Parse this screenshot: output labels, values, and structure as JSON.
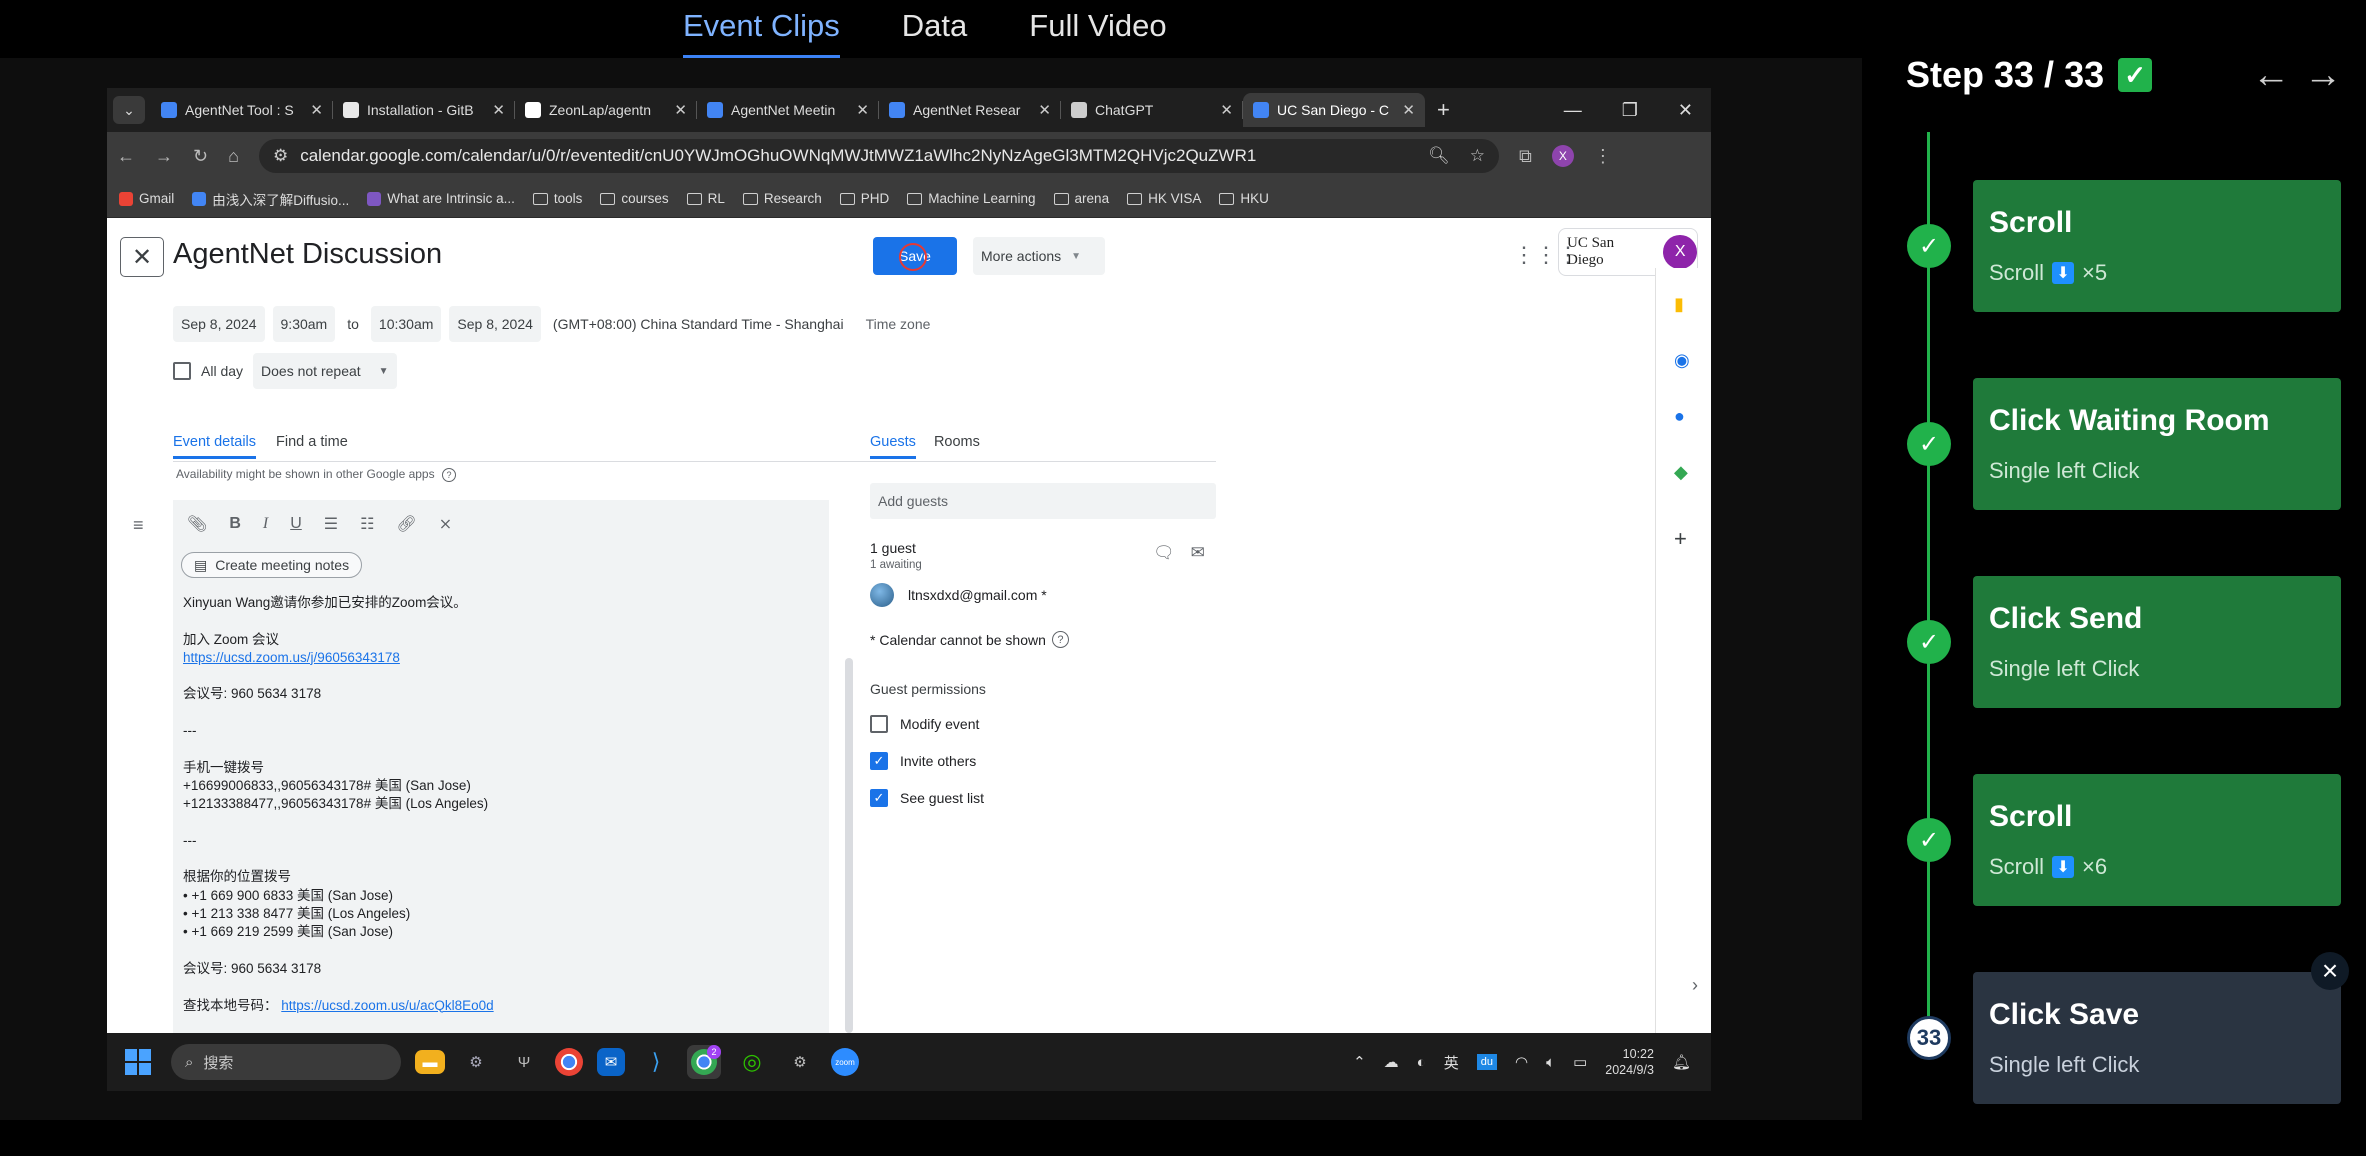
{
  "top_tabs": [
    "Event Clips",
    "Data",
    "Full Video"
  ],
  "browser": {
    "tabs": [
      {
        "label": "AgentNet Tool : S",
        "fav_color": "#4285f4"
      },
      {
        "label": "Installation - GitB",
        "fav_color": "#e8e8e8"
      },
      {
        "label": "ZeonLap/agentn",
        "fav_color": "#ffffff"
      },
      {
        "label": "AgentNet Meetin",
        "fav_color": "#4285f4"
      },
      {
        "label": "AgentNet Resear",
        "fav_color": "#4285f4"
      },
      {
        "label": "ChatGPT",
        "fav_color": "#cccccc"
      },
      {
        "label": "UC San Diego - C",
        "fav_color": "#4285f4"
      }
    ],
    "url": "calendar.google.com/calendar/u/0/r/eventedit/cnU0YWJmOGhuOWNqMWJtMWZ1aWlhc2NyNzAgeGl3MTM2QHVjc2QuZWR1",
    "profile_initial": "X",
    "bookmarks": [
      "Gmail",
      "由浅入深了解Diffusio...",
      "What are Intrinsic a...",
      "tools",
      "courses",
      "RL",
      "Research",
      "PHD",
      "Machine Learning",
      "arena",
      "HK VISA",
      "HKU"
    ]
  },
  "event": {
    "title": "AgentNet Discussion",
    "save": "Save",
    "more_actions": "More actions",
    "org_logo": "UC San Diego",
    "user_initial": "X",
    "start_date": "Sep 8, 2024",
    "start_time": "9:30am",
    "to": "to",
    "end_time": "10:30am",
    "end_date": "Sep 8, 2024",
    "timezone_value": "(GMT+08:00) China Standard Time - Shanghai",
    "timezone_label": "Time zone",
    "all_day": "All day",
    "repeat": "Does not repeat",
    "tab_details": "Event details",
    "tab_find_time": "Find a time",
    "availability_note": "Availability might be shown in other Google apps",
    "create_notes": "Create meeting notes",
    "description_lines": [
      "Xinyuan Wang邀请你参加已安排的Zoom会议。",
      "",
      "加入 Zoom 会议",
      "https://ucsd.zoom.us/j/96056343178",
      "",
      "会议号: 960 5634 3178",
      "",
      "---",
      "",
      "手机一键拨号",
      "+16699006833,,96056343178# 美国 (San Jose)",
      "+12133388477,,96056343178# 美国 (Los Angeles)",
      "",
      "---",
      "",
      "根据你的位置拨号",
      "• +1 669 900 6833 美国 (San Jose)",
      "• +1 213 338 8477 美国 (Los Angeles)",
      "• +1 669 219 2599 美国 (San Jose)",
      "",
      "会议号: 960 5634 3178",
      "",
      "查找本地号码："
    ],
    "local_link": "https://ucsd.zoom.us/u/acQkl8Eo0d",
    "guests_tab": "Guests",
    "rooms_tab": "Rooms",
    "add_guests_placeholder": "Add guests",
    "guest_count": "1 guest",
    "guest_awaiting": "1 awaiting",
    "guest_email": "ltnsxdxd@gmail.com *",
    "calendar_note": "* Calendar cannot be shown",
    "guest_permissions": "Guest permissions",
    "permissions": [
      {
        "label": "Modify event",
        "checked": false
      },
      {
        "label": "Invite others",
        "checked": true
      },
      {
        "label": "See guest list",
        "checked": true
      }
    ]
  },
  "taskbar": {
    "search": "搜索",
    "ime": "英",
    "time": "10:22",
    "date": "2024/9/3",
    "chrome_badge": "2"
  },
  "steps_panel": {
    "title": "Step 33 / 33",
    "steps": [
      {
        "title": "Scroll",
        "subtitle": "Scroll",
        "arrow": "⬇",
        "count": "×5",
        "current": false
      },
      {
        "title": "Click Waiting Room",
        "subtitle": "Single left Click",
        "current": false
      },
      {
        "title": "Click Send",
        "subtitle": "Single left Click",
        "current": false
      },
      {
        "title": "Scroll",
        "subtitle": "Scroll",
        "arrow": "⬇",
        "count": "×6",
        "current": false
      },
      {
        "title": "Click Save",
        "subtitle": "Single left Click",
        "current": true,
        "number": "33"
      }
    ]
  }
}
